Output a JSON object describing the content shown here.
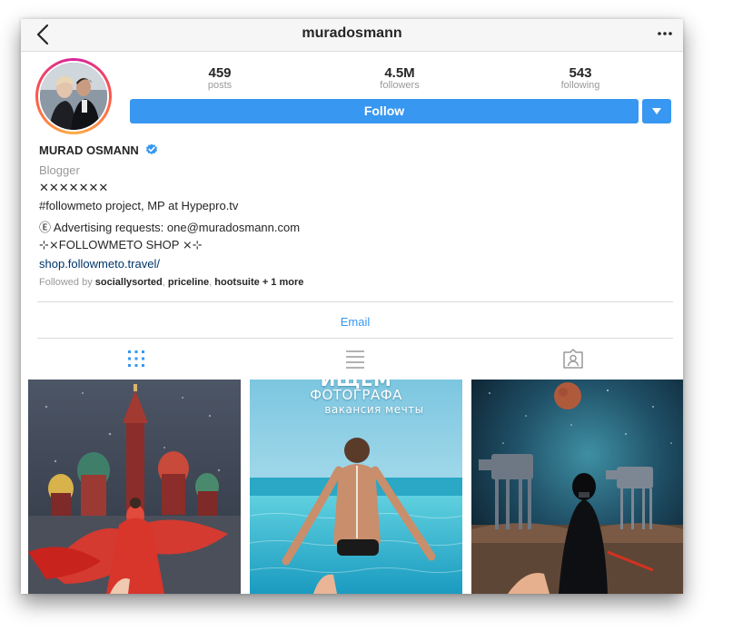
{
  "header": {
    "username": "muradosmann"
  },
  "stats": [
    {
      "value": "459",
      "label": "posts"
    },
    {
      "value": "4.5M",
      "label": "followers"
    },
    {
      "value": "543",
      "label": "following"
    }
  ],
  "actions": {
    "follow_label": "Follow",
    "email_label": "Email"
  },
  "profile": {
    "full_name": "MURAD OSMANN",
    "category": "Blogger",
    "bio_line1": "✕✕✕✕✕✕✕",
    "bio_line2": "#followmeto project, MP at Hypepro.tv",
    "bio_line3": "Ⓔ Advertising requests: one@muradosmann.com",
    "bio_line4": "⊹⨯FOLLOWMETO SHOP ⨯⊹",
    "website": "shop.followmeto.travel/",
    "followed_by_prefix": "Followed by",
    "followed_by": [
      "sociallysorted",
      "priceline",
      "hootsuite"
    ],
    "followed_by_more": "+ 1 more"
  },
  "posts": [
    {
      "caption_line1": "",
      "caption_line2": "",
      "caption_line3": ""
    },
    {
      "caption_line1": "ИЩЕМ",
      "caption_line2": "ФОТОГРАФА",
      "caption_line3": "вакансия мечты"
    },
    {
      "caption_line1": "",
      "caption_line2": "",
      "caption_line3": ""
    }
  ],
  "colors": {
    "accent": "#3897f0",
    "link": "#003569",
    "verified": "#3897f0"
  }
}
